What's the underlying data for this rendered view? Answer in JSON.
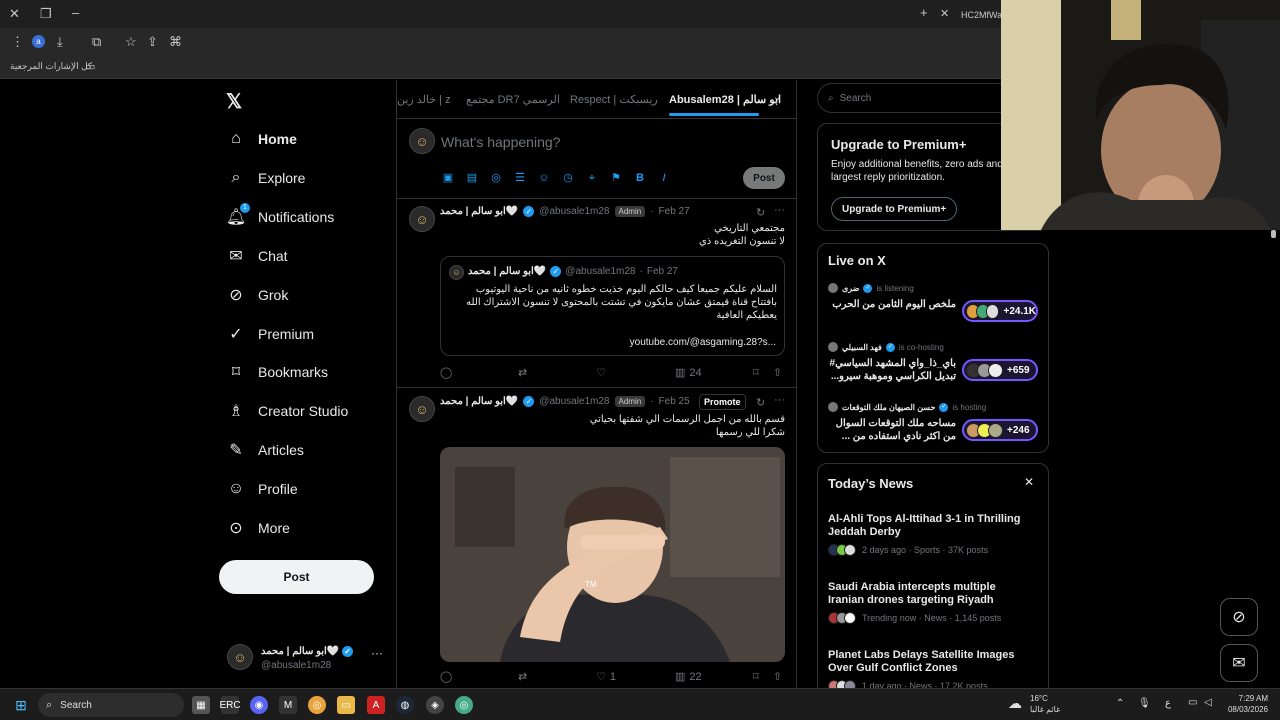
{
  "browser": {
    "tab_title": "HC2MfWa",
    "profile_initial": "a",
    "bookmarks_label": "كل الإشارات المرجعية"
  },
  "x": {
    "nav": [
      {
        "label": "Home",
        "icon": "home-icon"
      },
      {
        "label": "Explore",
        "icon": "search-icon"
      },
      {
        "label": "Notifications",
        "icon": "bell-icon",
        "badge": "1"
      },
      {
        "label": "Chat",
        "icon": "mail-icon"
      },
      {
        "label": "Grok",
        "icon": "grok-icon"
      },
      {
        "label": "Premium",
        "icon": "premium-icon"
      },
      {
        "label": "Bookmarks",
        "icon": "bookmark-icon"
      },
      {
        "label": "Creator Studio",
        "icon": "creator-icon"
      },
      {
        "label": "Articles",
        "icon": "articles-icon"
      },
      {
        "label": "Profile",
        "icon": "person-icon"
      },
      {
        "label": "More",
        "icon": "more-icon"
      }
    ],
    "post_button": "Post",
    "account": {
      "name": "ابو سالم | محمد🤍",
      "handle": "@abusale1m28"
    },
    "tabs": [
      "Abusalem28 | ابو سالم",
      "Respect | ريسبكت",
      "مجتمع DR7 الرسمي",
      "خالد زين | z"
    ],
    "composer": {
      "placeholder": "What's happening?",
      "post_label": "Post"
    },
    "posts": [
      {
        "name": "ابو سالم | محمد🤍",
        "handle": "@abusale1m28",
        "badge": "Admin",
        "date": "Feb 27",
        "text_line1": "مجتمعي التاريخي",
        "text_line2": "لا تنسون التغريده ذي",
        "quote": {
          "name": "ابو سالم | محمد🤍",
          "handle": "@abusale1m28",
          "date": "Feb 27",
          "text": "السلام عليكم جميعا كيف حالكم اليوم خذيت خطوه ثانيه من ناحية اليوتيوب بافتتاح قناة قيمتق عشان مايكون في تشتت بالمحتوى  لا تنسون الاشتراك الله يعطيكم العافية",
          "link": "youtube.com/@asgaming.28?s..."
        },
        "views": "24"
      },
      {
        "name": "ابو سالم | محمد🤍",
        "handle": "@abusale1m28",
        "badge": "Admin",
        "date": "Feb 25",
        "promote": "Promote",
        "text_line1": "قسم بالله من اجمل الرسمات الي شفتها بحياتي",
        "text_line2": "شكرا للي رسمها",
        "image_mark": "TM",
        "likes": "1",
        "views": "22"
      }
    ],
    "search_placeholder": "Search",
    "premium": {
      "title": "Upgrade to Premium+",
      "desc": "Enjoy additional benefits, zero ads and largest reply prioritization.",
      "button": "Upgrade to Premium+"
    },
    "live": {
      "title": "Live on X",
      "items": [
        {
          "host": "ضرى",
          "status": "is listening",
          "title_line1": "ملخص اليوم الثامن من الحرب",
          "title_line2": "",
          "count": "+24.1K"
        },
        {
          "host": "فهد السبيلي",
          "status": "is co-hosting",
          "title_line1": "باي_ذا_واي المشهد السياسي#",
          "title_line2": "تبديل الكراسي وموهبة سيرو...",
          "count": "+659"
        },
        {
          "host": "حسن الصيهان ملك التوقعات",
          "status": "is hosting",
          "title_line1": "مساحه ملك التوقعات السوال",
          "title_line2": "من اكثر نادي استفاده من ...",
          "count": "+246"
        }
      ]
    },
    "news": {
      "title": "Today’s News",
      "items": [
        {
          "title": "Al-Ahli Tops Al-Ittihad 3-1 in Thrilling Jeddah Derby",
          "meta": "2 days ago · Sports · 37K posts"
        },
        {
          "title": "Saudi Arabia intercepts multiple Iranian drones targeting Riyadh",
          "meta": "Trending now · News · 1,145 posts"
        },
        {
          "title": "Planet Labs Delays Satellite Images Over Gulf Conflict Zones",
          "meta": "1 day ago · News · 17.2K posts"
        }
      ]
    }
  },
  "taskbar": {
    "search": "Search",
    "weather_temp": "16°C",
    "weather_desc": "غائم غالبا",
    "lang": "ع",
    "time": "7:29 AM",
    "date": "08/03/2026"
  },
  "colors": {
    "accent": "#1d9bf0",
    "premium": "#7856ff"
  }
}
